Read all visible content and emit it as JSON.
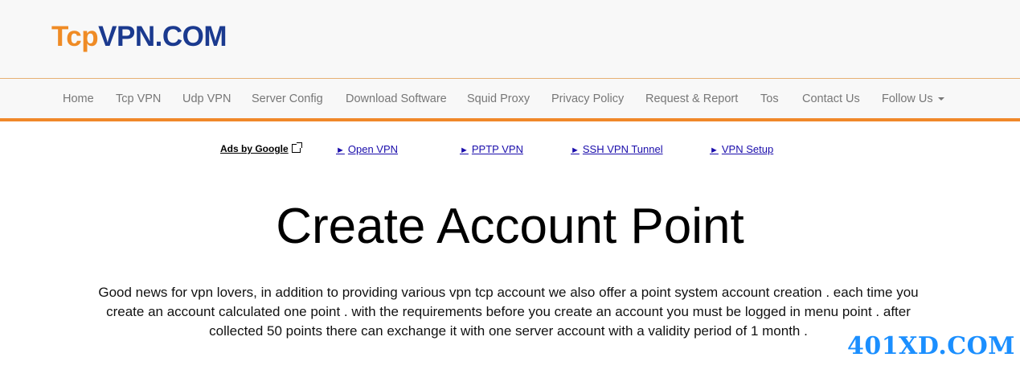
{
  "logo": {
    "part1": "Tcp",
    "part2": "VPN.COM"
  },
  "nav": {
    "items": [
      {
        "label": "Home"
      },
      {
        "label": "Tcp VPN"
      },
      {
        "label": "Udp VPN"
      },
      {
        "label": "Server Config"
      },
      {
        "label": "Download Software"
      },
      {
        "label": "Squid Proxy"
      },
      {
        "label": "Privacy Policy"
      },
      {
        "label": "Request & Report"
      },
      {
        "label": "Tos"
      },
      {
        "label": "Contact Us"
      },
      {
        "label": "Follow Us"
      }
    ]
  },
  "ads": {
    "label": "Ads by Google",
    "links": [
      {
        "label": "Open VPN"
      },
      {
        "label": "PPTP VPN"
      },
      {
        "label": "SSH VPN Tunnel"
      },
      {
        "label": "VPN Setup"
      }
    ]
  },
  "main": {
    "title": "Create Account Point",
    "description": "Good news for vpn lovers, in addition to providing various vpn tcp account we also offer a point system account creation . each time you create an account calculated one point . with the requirements before you create an account you must be logged in menu point . after collected 50 points there can exchange it with one server account with a validity period of 1 month ."
  },
  "watermark": "401XD.COM",
  "colors": {
    "brand_orange": "#ef8b25",
    "brand_blue": "#1b3a8f",
    "nav_border": "#f0882a",
    "link": "#1a0dab",
    "watermark": "#1b8fff"
  },
  "icons": {
    "follow_dropdown": "caret-down-icon",
    "ads_external": "external-link-icon",
    "ad_bullet": "triangle-right-icon"
  }
}
